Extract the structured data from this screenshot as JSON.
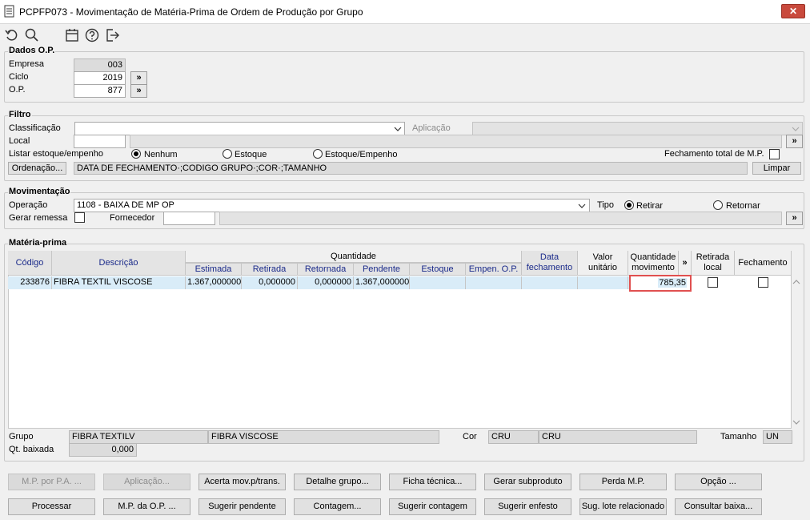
{
  "window": {
    "title": "PCPFP073 - Movimentação de Matéria-Prima de Ordem de Produção por Grupo",
    "close": "✕"
  },
  "toolbar": {
    "icons": [
      "undo-icon",
      "search-icon",
      "calendar-icon",
      "help-icon",
      "exit-icon"
    ]
  },
  "dados_op": {
    "legend": "Dados O.P.",
    "empresa_label": "Empresa",
    "empresa_value": "003",
    "ciclo_label": "Ciclo",
    "ciclo_value": "2019",
    "op_label": "O.P.",
    "op_value": "877",
    "lookup": "»"
  },
  "filtro": {
    "legend": "Filtro",
    "classificacao_label": "Classificação",
    "classificacao_value": "",
    "aplicacao_label": "Aplicação",
    "aplicacao_value": "",
    "local_label": "Local",
    "local_value": "",
    "listar_label": "Listar estoque/empenho",
    "radio_nenhum": "Nenhum",
    "radio_estoque": "Estoque",
    "radio_estoque_empenho": "Estoque/Empenho",
    "listar_selected": "Nenhum",
    "fechamento_label": "Fechamento total de M.P.",
    "ordenacao_button": "Ordenação...",
    "ordenacao_value": "DATA DE FECHAMENTO·;CODIGO GRUPO·;COR·;TAMANHO",
    "limpar_button": "Limpar"
  },
  "movimentacao": {
    "legend": "Movimentação",
    "operacao_label": "Operação",
    "operacao_value": "1108 - BAIXA DE MP OP",
    "tipo_label": "Tipo",
    "tipo_retirar": "Retirar",
    "tipo_retornar": "Retornar",
    "tipo_selected": "Retirar",
    "gerar_remessa_label": "Gerar remessa",
    "fornecedor_label": "Fornecedor",
    "fornecedor_value": ""
  },
  "materia_prima": {
    "legend": "Matéria-prima",
    "headers": {
      "codigo": "Código",
      "descricao": "Descrição",
      "quantidade": "Quantidade",
      "estimada": "Estimada",
      "retirada": "Retirada",
      "retornada": "Retornada",
      "pendente": "Pendente",
      "estoque": "Estoque",
      "empen_op": "Empen. O.P.",
      "data_fechamento": "Data fechamento",
      "valor_unitario": "Valor unitário",
      "quantidade_movimento": "Quantidade movimento",
      "expand": "»",
      "retirada_local": "Retirada local",
      "fechamento": "Fechamento"
    },
    "rows": [
      {
        "codigo": "233876",
        "descricao": "FIBRA TEXTIL VISCOSE",
        "estimada": "1.367,000000",
        "retirada": "0,000000",
        "retornada": "0,000000",
        "pendente": "1.367,000000",
        "estoque": "",
        "empen_op": "",
        "data_fechamento": "",
        "valor_unitario": "",
        "quantidade_movimento": "785,35"
      }
    ],
    "grupo_label": "Grupo",
    "grupo_code": "FIBRA TEXTILV",
    "grupo_desc": "FIBRA VISCOSE",
    "cor_label": "Cor",
    "cor_code": "CRU",
    "cor_desc": "CRU",
    "tamanho_label": "Tamanho",
    "tamanho_value": "UN",
    "qt_baixada_label": "Qt. baixada",
    "qt_baixada_value": "0,000"
  },
  "buttons_row1": [
    "M.P. por P.A. ...",
    "Aplicação...",
    "Acerta mov.p/trans.",
    "Detalhe grupo...",
    "Ficha técnica...",
    "Gerar subproduto",
    "Perda M.P.",
    "Opção ..."
  ],
  "buttons_row2": [
    "Processar",
    "M.P. da O.P. ...",
    "Sugerir pendente",
    "Contagem...",
    "Sugerir contagem",
    "Sugerir enfesto",
    "Sug. lote relacionado",
    "Consultar baixa..."
  ],
  "colors": {
    "highlight": "#d9ecf8",
    "selected_border": "#e05050",
    "header_text": "#1a2a8a"
  }
}
